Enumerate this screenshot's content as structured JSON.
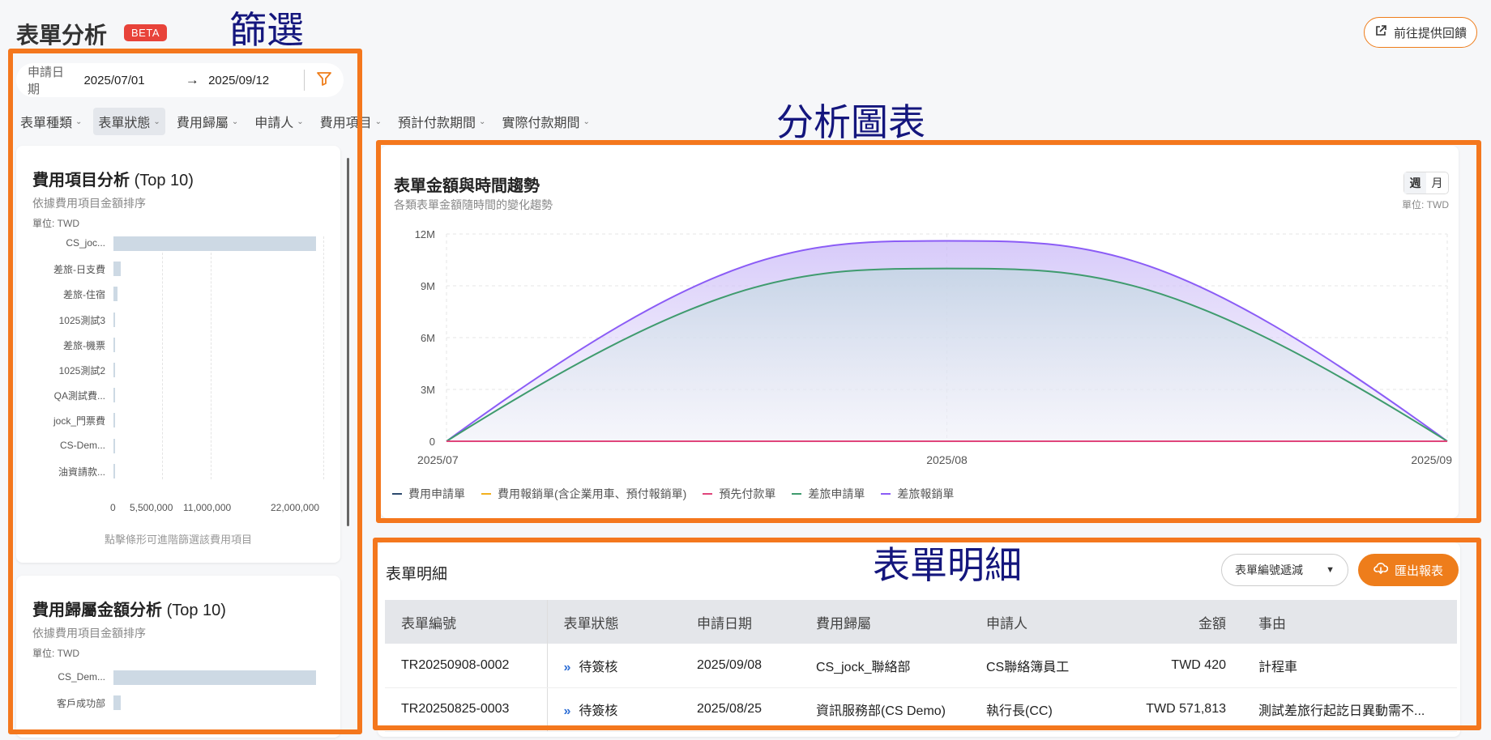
{
  "header": {
    "title": "表單分析",
    "badge": "BETA",
    "feedback_label": "前往提供回饋"
  },
  "annotations": {
    "filter": "篩選",
    "charts": "分析圖表",
    "details": "表單明細"
  },
  "date_filter": {
    "label": "申請日期",
    "start": "2025/07/01",
    "arrow": "→",
    "end": "2025/09/12"
  },
  "filter_chips": [
    {
      "label": "表單種類",
      "active": false
    },
    {
      "label": "表單狀態",
      "active": true
    },
    {
      "label": "費用歸屬",
      "active": false
    },
    {
      "label": "申請人",
      "active": false
    },
    {
      "label": "費用項目",
      "active": false
    },
    {
      "label": "預計付款期間",
      "active": false
    },
    {
      "label": "實際付款期間",
      "active": false
    }
  ],
  "expense_card": {
    "title": "費用項目分析",
    "title_suffix": "(Top 10)",
    "subtitle": "依據費用項目金額排序",
    "unit": "單位: TWD",
    "hint": "點擊條形可進階篩選該費用項目",
    "ticks": [
      "0",
      "5,500,000",
      "11,000,000",
      "22,000,000"
    ]
  },
  "attribution_card": {
    "title": "費用歸屬金額分析",
    "title_suffix": "(Top 10)",
    "subtitle": "依據費用項目金額排序",
    "unit": "單位: TWD"
  },
  "trend_card": {
    "title": "表單金額與時間趨勢",
    "subtitle": "各類表單金額隨時間的變化趨勢",
    "unit": "單位: TWD",
    "toggle": {
      "week": "週",
      "month": "月"
    }
  },
  "table_card": {
    "title": "表單明細",
    "sort_label": "表單編號遞減",
    "export_label": "匯出報表",
    "columns": [
      "表單編號",
      "表單狀態",
      "申請日期",
      "費用歸屬",
      "申請人",
      "金額",
      "事由"
    ],
    "rows": [
      {
        "id": "TR20250908-0002",
        "status": "待簽核",
        "date": "2025/09/08",
        "dept": "CS_jock_聯絡部",
        "applicant": "CS聯絡簿員工",
        "amount": "TWD 420",
        "reason": "計程車"
      },
      {
        "id": "TR20250825-0003",
        "status": "待簽核",
        "date": "2025/08/25",
        "dept": "資訊服務部(CS Demo)",
        "applicant": "執行長(CC)",
        "amount": "TWD 571,813",
        "reason": "測試差旅行起訖日異動需不..."
      }
    ]
  },
  "colors": {
    "accent": "#ee7d1b",
    "badge": "#e8433a",
    "annotation": "#f4771d"
  },
  "chart_data": [
    {
      "type": "bar",
      "orientation": "horizontal",
      "title": "費用項目分析 (Top 10)",
      "categories": [
        "CS_joc...",
        "差旅-日支費",
        "差旅-住宿",
        "1025測試3",
        "差旅-機票",
        "1025測試2",
        "QA測試費...",
        "jock_門票費",
        "CS-Dem...",
        "油資請款..."
      ],
      "values": [
        21600000,
        800000,
        400000,
        150000,
        60000,
        30000,
        20000,
        15000,
        10000,
        5000
      ],
      "xlim": [
        0,
        22000000
      ],
      "xticks": [
        0,
        5500000,
        11000000,
        22000000
      ],
      "grid": true
    },
    {
      "type": "bar",
      "orientation": "horizontal",
      "title": "費用歸屬金額分析 (Top 10)",
      "categories": [
        "CS_Dem...",
        "客戶成功部"
      ],
      "values": [
        21600000,
        800000
      ],
      "xlim": [
        0,
        22000000
      ]
    },
    {
      "type": "area",
      "title": "表單金額與時間趨勢",
      "x": [
        "2025/07",
        "2025/08",
        "2025/09"
      ],
      "yticks": [
        "0",
        "3M",
        "6M",
        "9M",
        "12M"
      ],
      "ylim": [
        0,
        12000000
      ],
      "grid": true,
      "legend": "bottom-left",
      "series": [
        {
          "name": "費用申請單",
          "color": "#2c4a6e",
          "values": [
            0,
            0,
            0
          ]
        },
        {
          "name": "費用報銷單(含企業用車、預付報銷單)",
          "color": "#f2b01e",
          "values": [
            0,
            0,
            0
          ]
        },
        {
          "name": "預先付款單",
          "color": "#e0457b",
          "values": [
            0,
            0,
            0
          ]
        },
        {
          "name": "差旅申請單",
          "color": "#3f9b6e",
          "values": [
            0,
            10000000,
            0
          ]
        },
        {
          "name": "差旅報銷單",
          "color": "#8b5cf6",
          "values": [
            0,
            11600000,
            0
          ]
        }
      ]
    }
  ]
}
